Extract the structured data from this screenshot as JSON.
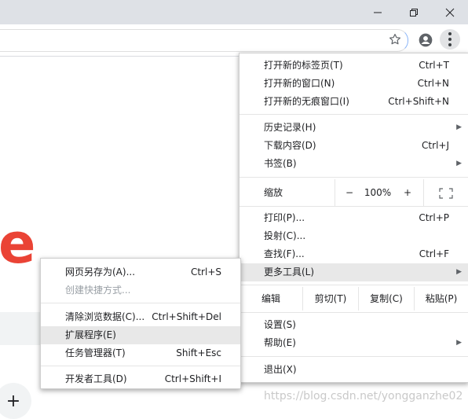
{
  "window": {
    "minimize_icon": "minimize-icon",
    "restore_icon": "restore-icon",
    "close_icon": "close-icon"
  },
  "toolbar": {
    "bookmark_icon": "star-icon",
    "profile_icon": "account-circle-icon",
    "menu_icon": "more-vert-icon"
  },
  "page": {
    "logo_letter": "e",
    "add_shortcut": "+",
    "watermark": "https://blog.csdn.net/yongganzhe02"
  },
  "main_menu": {
    "new_tab": {
      "label": "打开新的标签页(T)",
      "shortcut": "Ctrl+T"
    },
    "new_window": {
      "label": "打开新的窗口(N)",
      "shortcut": "Ctrl+N"
    },
    "new_incognito": {
      "label": "打开新的无痕窗口(I)",
      "shortcut": "Ctrl+Shift+N"
    },
    "history": {
      "label": "历史记录(H)"
    },
    "downloads": {
      "label": "下载内容(D)",
      "shortcut": "Ctrl+J"
    },
    "bookmarks": {
      "label": "书签(B)"
    },
    "zoom": {
      "label": "缩放",
      "minus": "−",
      "value": "100%",
      "plus": "+"
    },
    "print": {
      "label": "打印(P)...",
      "shortcut": "Ctrl+P"
    },
    "cast": {
      "label": "投射(C)..."
    },
    "find": {
      "label": "查找(F)...",
      "shortcut": "Ctrl+F"
    },
    "more_tools": {
      "label": "更多工具(L)"
    },
    "edit": {
      "label": "编辑",
      "cut": "剪切(T)",
      "copy": "复制(C)",
      "paste": "粘贴(P)"
    },
    "settings": {
      "label": "设置(S)"
    },
    "help": {
      "label": "帮助(E)"
    },
    "exit": {
      "label": "退出(X)"
    }
  },
  "sub_menu": {
    "save_page": {
      "label": "网页另存为(A)...",
      "shortcut": "Ctrl+S"
    },
    "create_shortcut": {
      "label": "创建快捷方式..."
    },
    "clear_data": {
      "label": "清除浏览数据(C)...",
      "shortcut": "Ctrl+Shift+Del"
    },
    "extensions": {
      "label": "扩展程序(E)"
    },
    "task_manager": {
      "label": "任务管理器(T)",
      "shortcut": "Shift+Esc"
    },
    "dev_tools": {
      "label": "开发者工具(D)",
      "shortcut": "Ctrl+Shift+I"
    }
  }
}
